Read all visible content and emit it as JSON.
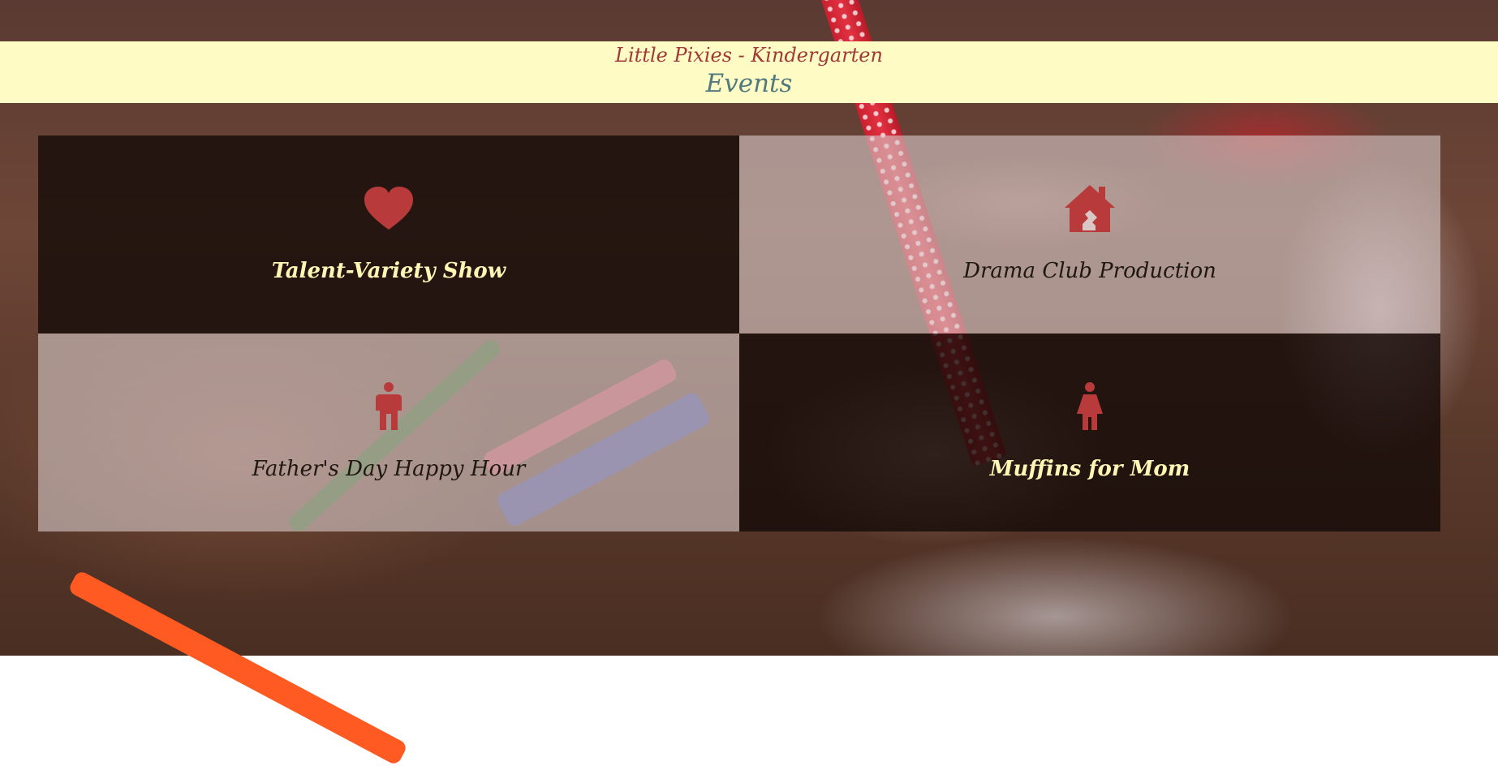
{
  "header": {
    "site_title": "Little Pixies - Kindergarten",
    "page_title": "Events"
  },
  "events": [
    {
      "label": "Talent-Variety Show",
      "icon": "heart-icon"
    },
    {
      "label": "Drama Club Production",
      "icon": "house-icon"
    },
    {
      "label": "Father's Day Happy Hour",
      "icon": "male-figure-icon"
    },
    {
      "label": "Muffins for Mom",
      "icon": "female-figure-icon"
    }
  ],
  "colors": {
    "header_bg": "#fffbc4",
    "site_title": "#a03a3a",
    "page_title": "#4e7a80",
    "icon": "#b83a3a",
    "dark_tile_text": "#fff6b6",
    "light_tile_text": "#1f1712"
  }
}
